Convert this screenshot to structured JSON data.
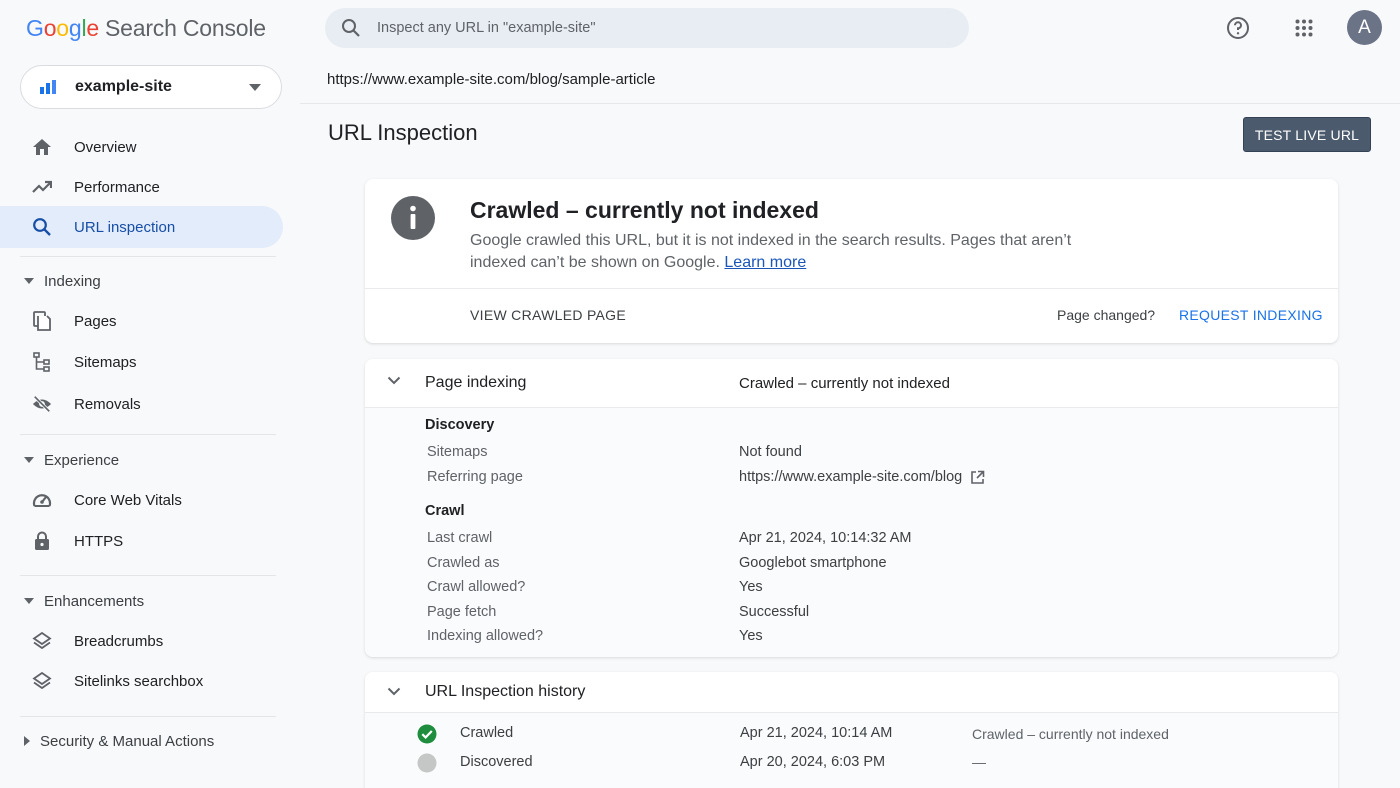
{
  "app": {
    "logo_google": [
      "G",
      "o",
      "o",
      "g",
      "l",
      "e"
    ],
    "logo_product": "Search Console"
  },
  "property": {
    "name": "example-site"
  },
  "search": {
    "placeholder": "Inspect any URL in \"example-site\""
  },
  "topbar": {
    "avatar_letter": "A"
  },
  "sidebar": {
    "items": [
      {
        "label": "Overview",
        "icon": "home-icon"
      },
      {
        "label": "Performance",
        "icon": "trending-up-icon"
      },
      {
        "label": "URL inspection",
        "icon": "search-icon",
        "active": true
      }
    ],
    "sections": [
      {
        "label": "Indexing",
        "items": [
          {
            "label": "Pages",
            "icon": "pages-icon"
          },
          {
            "label": "Sitemaps",
            "icon": "sitemap-icon"
          },
          {
            "label": "Removals",
            "icon": "visibility-off-icon"
          }
        ]
      },
      {
        "label": "Experience",
        "items": [
          {
            "label": "Core Web Vitals",
            "icon": "speed-gauge-icon"
          },
          {
            "label": "HTTPS",
            "icon": "lock-icon"
          }
        ]
      },
      {
        "label": "Enhancements",
        "items": [
          {
            "label": "Breadcrumbs",
            "icon": "layers-icon"
          },
          {
            "label": "Sitelinks searchbox",
            "icon": "layers-icon"
          }
        ]
      },
      {
        "label": "Security & Manual Actions",
        "collapsed": true
      }
    ]
  },
  "main": {
    "inspected_url": "https://www.example-site.com/blog/sample-article",
    "page_title": "URL Inspection",
    "test_live_url": "TEST LIVE URL",
    "status_card": {
      "title": "Crawled – currently not indexed",
      "description": "Google crawled this URL, but it is not indexed in the search results. Pages that aren’t indexed can’t be shown on Google.",
      "learn_more": "Learn more",
      "view_crawled_page": "VIEW CRAWLED PAGE",
      "page_changed": "Page changed?",
      "request_indexing": "REQUEST INDEXING"
    },
    "page_indexing": {
      "title": "Page indexing",
      "value": "Crawled – currently not indexed",
      "discovery": {
        "title": "Discovery",
        "rows": [
          {
            "label": "Sitemaps",
            "value": "Not found"
          },
          {
            "label": "Referring page",
            "value": "https://www.example-site.com/blog"
          }
        ]
      },
      "crawl": {
        "title": "Crawl",
        "rows": [
          {
            "label": "Last crawl",
            "value": "Apr 21, 2024, 10:14:32 AM"
          },
          {
            "label": "Crawled as",
            "value": "Googlebot smartphone"
          },
          {
            "label": "Crawl allowed?",
            "value": "Yes"
          },
          {
            "label": "Page fetch",
            "value": "Successful"
          },
          {
            "label": "Indexing allowed?",
            "value": "Yes"
          }
        ]
      }
    },
    "history": {
      "title": "URL Inspection history",
      "rows": [
        {
          "event": "Crawled",
          "date": "Apr 21, 2024, 10:14 AM",
          "status": "Crawled – currently not indexed",
          "icon": "check-circle-icon"
        },
        {
          "event": "Discovered",
          "date": "Apr 20, 2024, 6:03 PM",
          "status": "—",
          "icon": "grey-dot-icon"
        }
      ]
    }
  },
  "colors": {
    "accent": "#1a73e8",
    "active_nav_bg": "#e3ecfa",
    "success": "#1e8e3e",
    "neutral_dot": "#c4c7c5",
    "button_bg": "#4b5a6d"
  }
}
